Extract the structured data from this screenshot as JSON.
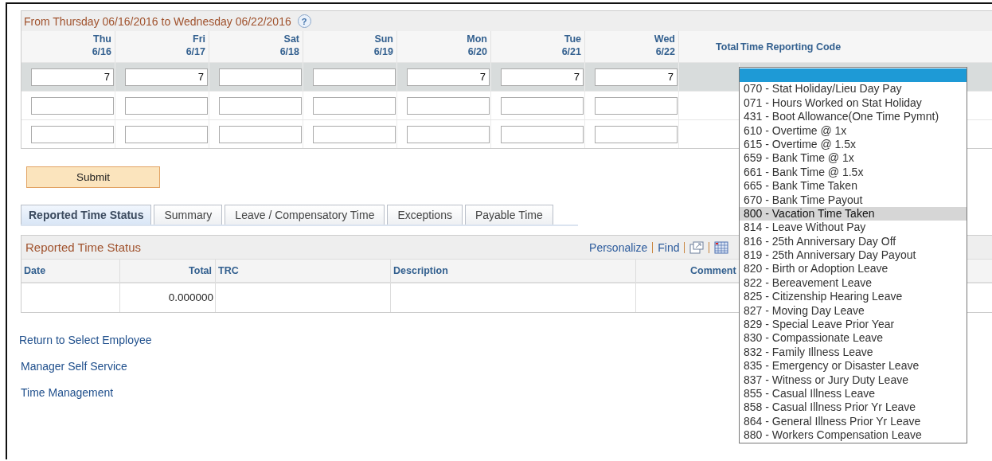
{
  "timesheet": {
    "title": "From Thursday 06/16/2016 to Wednesday 06/22/2016",
    "help": "?",
    "days": [
      {
        "day": "Thu",
        "date": "6/16"
      },
      {
        "day": "Fri",
        "date": "6/17"
      },
      {
        "day": "Sat",
        "date": "6/18"
      },
      {
        "day": "Sun",
        "date": "6/19"
      },
      {
        "day": "Mon",
        "date": "6/20"
      },
      {
        "day": "Tue",
        "date": "6/21"
      },
      {
        "day": "Wed",
        "date": "6/22"
      }
    ],
    "total_header": "Total",
    "trc_header": "Time Reporting Code",
    "rows": [
      {
        "selected": true,
        "hours": [
          {
            "kind": "filled",
            "value": "7"
          },
          {
            "kind": "filled",
            "value": "7"
          },
          {
            "kind": "empty"
          },
          {
            "kind": "empty"
          },
          {
            "kind": "filled",
            "value": "7"
          },
          {
            "kind": "filled",
            "value": "7"
          },
          {
            "kind": "filled",
            "value": "7"
          }
        ]
      },
      {
        "selected": false,
        "hours": [
          {
            "kind": "empty"
          },
          {
            "kind": "empty"
          },
          {
            "kind": "empty"
          },
          {
            "kind": "empty"
          },
          {
            "kind": "empty"
          },
          {
            "kind": "empty"
          },
          {
            "kind": "empty"
          }
        ]
      },
      {
        "selected": false,
        "hours": [
          {
            "kind": "empty"
          },
          {
            "kind": "empty"
          },
          {
            "kind": "empty"
          },
          {
            "kind": "empty"
          },
          {
            "kind": "empty"
          },
          {
            "kind": "empty"
          },
          {
            "kind": "empty"
          }
        ]
      }
    ]
  },
  "trc_dropdown": {
    "blank_option_selected": true,
    "options": [
      {
        "label": "070 - Stat Holiday/Lieu Day Pay",
        "hovered": false
      },
      {
        "label": "071 - Hours Worked on Stat Holiday",
        "hovered": false
      },
      {
        "label": "431 - Boot Allowance(One Time Pymnt)",
        "hovered": false
      },
      {
        "label": "610 - Overtime @ 1x",
        "hovered": false
      },
      {
        "label": "615 - Overtime @ 1.5x",
        "hovered": false
      },
      {
        "label": "659 - Bank Time @ 1x",
        "hovered": false
      },
      {
        "label": "661 - Bank Time @ 1.5x",
        "hovered": false
      },
      {
        "label": "665 - Bank Time Taken",
        "hovered": false
      },
      {
        "label": "670 - Bank Time Payout",
        "hovered": false
      },
      {
        "label": "800 - Vacation Time Taken",
        "hovered": true
      },
      {
        "label": "814 - Leave Without Pay",
        "hovered": false
      },
      {
        "label": "816 - 25th  Anniversary Day Off",
        "hovered": false
      },
      {
        "label": "819 - 25th Anniversary Day Payout",
        "hovered": false
      },
      {
        "label": "820 - Birth or Adoption Leave",
        "hovered": false
      },
      {
        "label": "822 - Bereavement Leave",
        "hovered": false
      },
      {
        "label": "825 - Citizenship Hearing Leave",
        "hovered": false
      },
      {
        "label": "827 - Moving Day Leave",
        "hovered": false
      },
      {
        "label": "829 - Special Leave Prior Year",
        "hovered": false
      },
      {
        "label": "830 - Compassionate Leave",
        "hovered": false
      },
      {
        "label": "832 - Family Illness Leave",
        "hovered": false
      },
      {
        "label": "835 - Emergency or Disaster Leave",
        "hovered": false
      },
      {
        "label": "837 - Witness or Jury Duty Leave",
        "hovered": false
      },
      {
        "label": "855 - Casual Illness Leave",
        "hovered": false
      },
      {
        "label": "858 - Casual Illness Prior Yr Leave",
        "hovered": false
      },
      {
        "label": "864 - General Illness Prior Yr Leave",
        "hovered": false
      },
      {
        "label": "880 - Workers Compensation Leave",
        "hovered": false
      }
    ]
  },
  "submit_button": "Submit",
  "tabs": [
    {
      "label": "Reported Time Status",
      "selected": true
    },
    {
      "label": "Summary",
      "selected": false
    },
    {
      "label": "Leave / Compensatory Time",
      "selected": false
    },
    {
      "label": "Exceptions",
      "selected": false
    },
    {
      "label": "Payable Time",
      "selected": false
    }
  ],
  "status_grid": {
    "title": "Reported Time Status",
    "toolbar": [
      "Personalize",
      "Find"
    ],
    "columns": [
      "Date",
      "Total",
      "TRC",
      "Description",
      "Comment"
    ],
    "rows": [
      {
        "total": "0.000000"
      }
    ]
  },
  "links": [
    "Return to Select Employee",
    "Manager Self Service",
    "Time Management"
  ]
}
